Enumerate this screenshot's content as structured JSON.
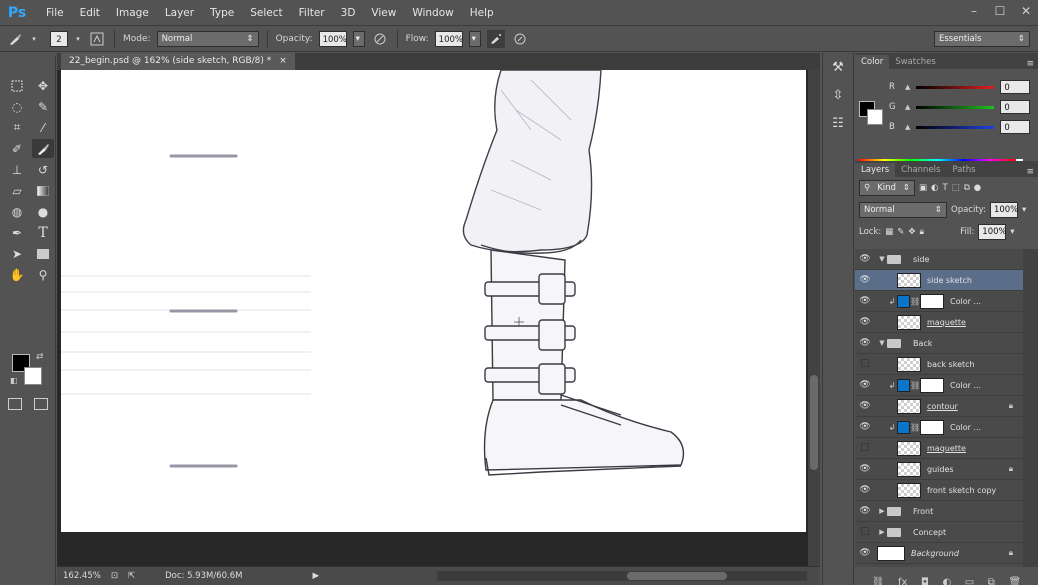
{
  "menu": {
    "logo": "Ps",
    "items": [
      "File",
      "Edit",
      "Image",
      "Layer",
      "Type",
      "Select",
      "Filter",
      "3D",
      "View",
      "Window",
      "Help"
    ]
  },
  "options": {
    "brush_size": "2",
    "mode_label": "Mode:",
    "mode_value": "Normal",
    "opacity_label": "Opacity:",
    "opacity_value": "100%",
    "flow_label": "Flow:",
    "flow_value": "100%",
    "workspace": "Essentials"
  },
  "document": {
    "tab_title": "22_begin.psd @ 162% (side sketch, RGB/8) *",
    "close_glyph": "×"
  },
  "status": {
    "zoom": "162.45%",
    "doc_info": "Doc: 5.93M/60.6M"
  },
  "color_panel": {
    "tabs": [
      "Color",
      "Swatches"
    ],
    "channels": [
      {
        "label": "R",
        "value": "0",
        "color": "#e02020"
      },
      {
        "label": "G",
        "value": "0",
        "color": "#20c020"
      },
      {
        "label": "B",
        "value": "0",
        "color": "#2040e0"
      }
    ]
  },
  "layers_panel": {
    "tabs": [
      "Layers",
      "Channels",
      "Paths"
    ],
    "filter_kind": "Kind",
    "blend_mode": "Normal",
    "opacity_label": "Opacity:",
    "opacity_value": "100%",
    "lock_label": "Lock:",
    "fill_label": "Fill:",
    "fill_value": "100%",
    "layers": [
      {
        "name": "side",
        "kind": "group",
        "expanded": true,
        "visible": true,
        "indent": 0
      },
      {
        "name": "side sketch",
        "kind": "pixel",
        "visible": true,
        "indent": 1,
        "selected": true
      },
      {
        "name": "Color ...",
        "kind": "adjust",
        "visible": true,
        "indent": 1,
        "clipped": true
      },
      {
        "name": "maquette",
        "kind": "pixel",
        "visible": true,
        "indent": 1,
        "underline": true
      },
      {
        "name": "Back",
        "kind": "group",
        "expanded": true,
        "visible": true,
        "indent": 0
      },
      {
        "name": "back sketch",
        "kind": "pixel",
        "visible": false,
        "indent": 1
      },
      {
        "name": "Color ...",
        "kind": "adjust",
        "visible": true,
        "indent": 1,
        "clipped": true
      },
      {
        "name": "contour",
        "kind": "pixel",
        "visible": true,
        "indent": 1,
        "underline": true,
        "locked": true
      },
      {
        "name": "Color ...",
        "kind": "adjust",
        "visible": true,
        "indent": 1,
        "clipped": true
      },
      {
        "name": "maquette",
        "kind": "pixel",
        "visible": false,
        "indent": 1,
        "underline": true
      },
      {
        "name": "guides",
        "kind": "pixel",
        "visible": true,
        "indent": 1,
        "locked": true
      },
      {
        "name": "front sketch copy",
        "kind": "pixel",
        "visible": true,
        "indent": 1
      },
      {
        "name": "Front",
        "kind": "group",
        "expanded": false,
        "visible": true,
        "indent": 0
      },
      {
        "name": "Concept",
        "kind": "group",
        "expanded": false,
        "visible": false,
        "indent": 0
      },
      {
        "name": "Background",
        "kind": "background",
        "visible": true,
        "indent": 0,
        "italic": true,
        "locked": true
      }
    ]
  }
}
